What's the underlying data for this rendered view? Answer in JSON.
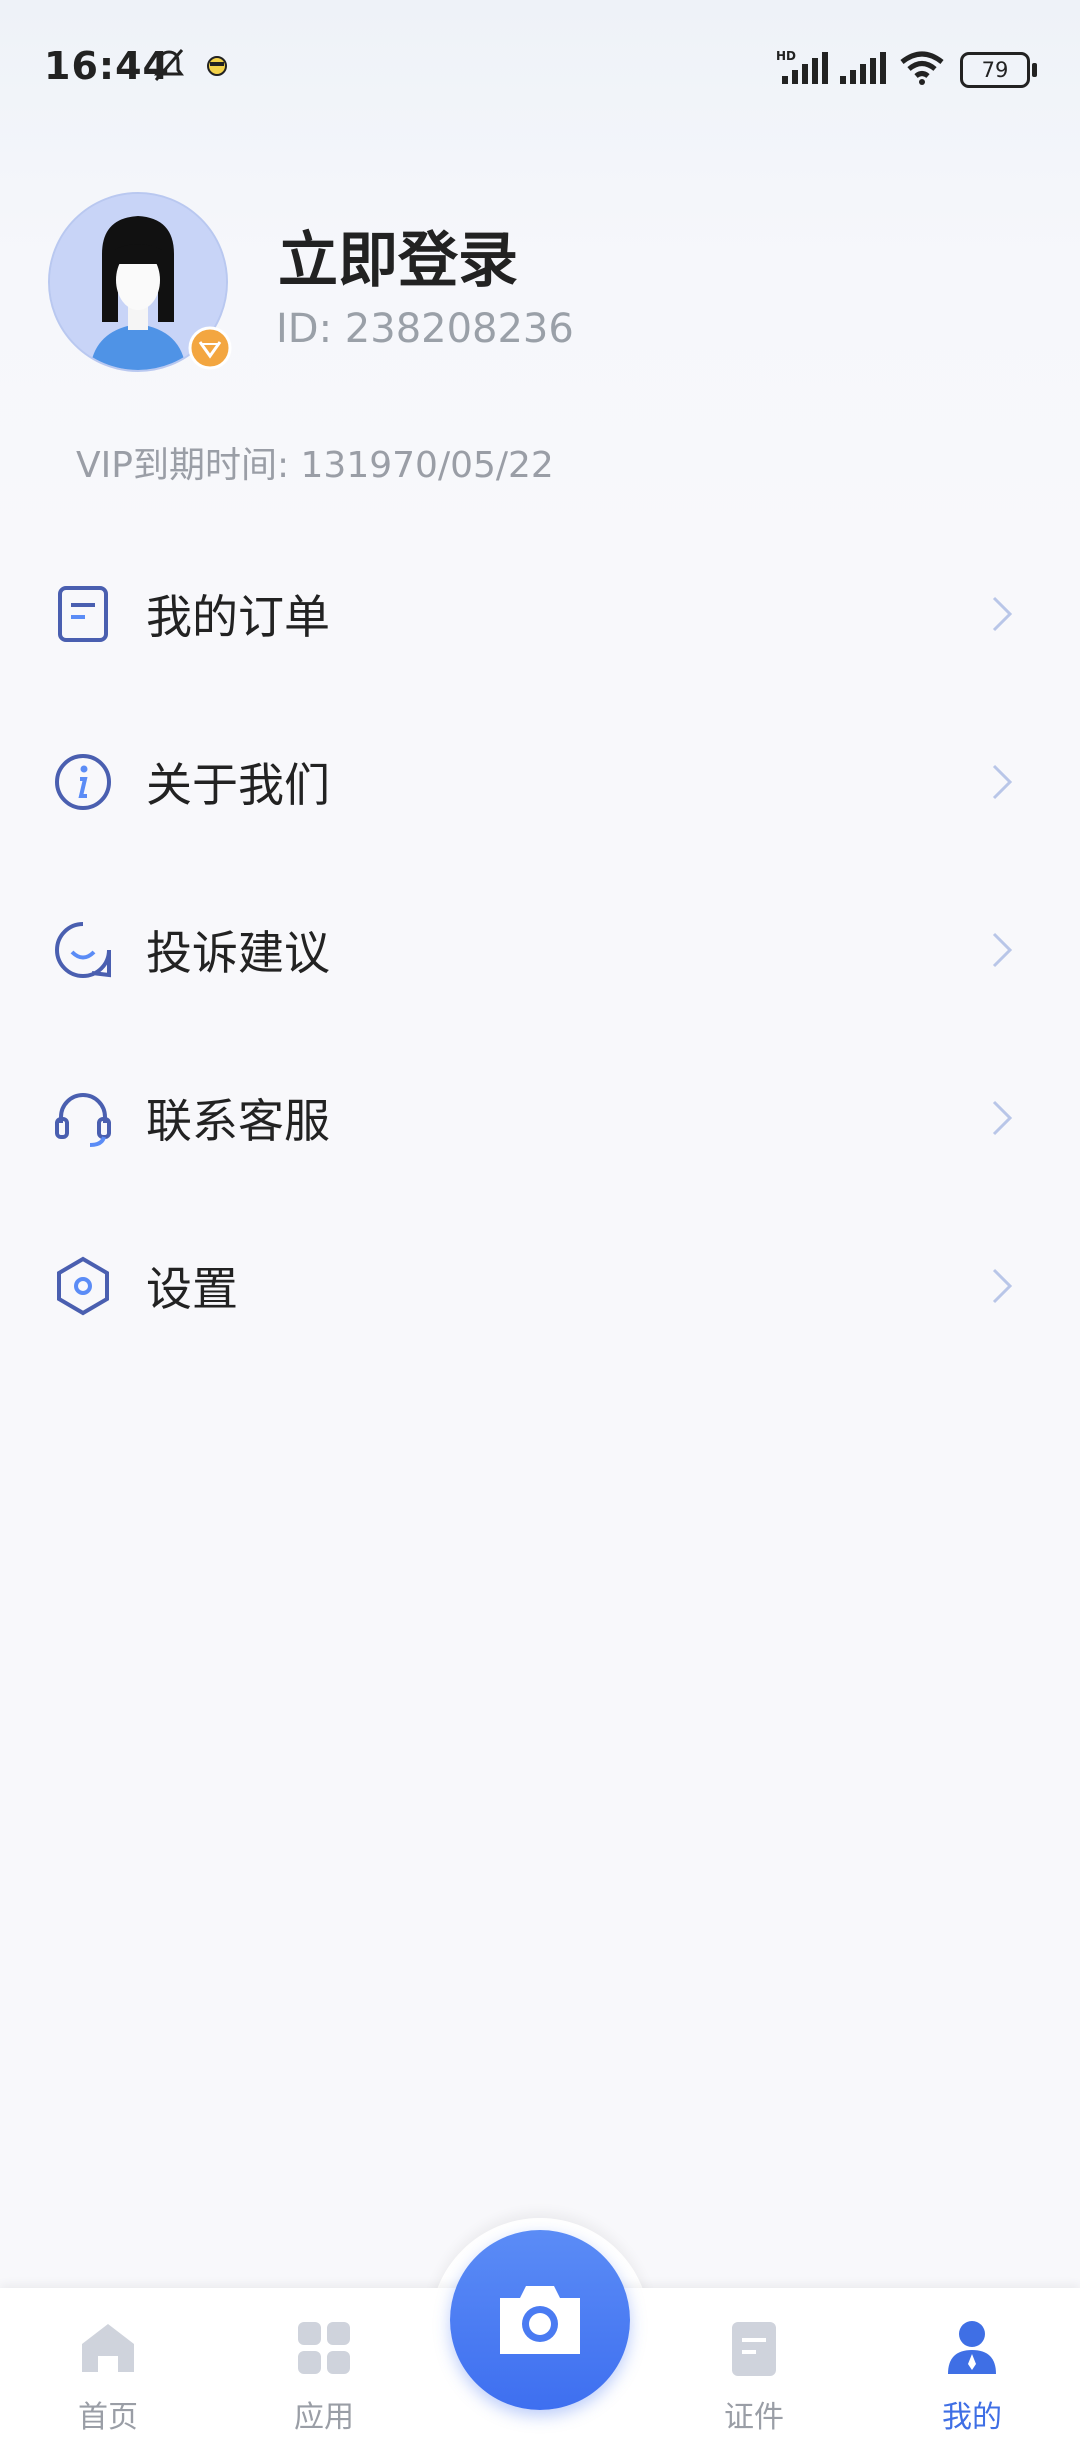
{
  "status_bar": {
    "time": "16:44",
    "battery": "79",
    "network_label": "HD"
  },
  "profile": {
    "title": "立即登录",
    "user_id": "ID: 238208236",
    "vip_expire": "VIP到期时间: 131970/05/22"
  },
  "menu": {
    "items": [
      {
        "label": "我的订单",
        "icon": "order-icon"
      },
      {
        "label": "关于我们",
        "icon": "info-icon"
      },
      {
        "label": "投诉建议",
        "icon": "chat-icon"
      },
      {
        "label": "联系客服",
        "icon": "headset-icon"
      },
      {
        "label": "设置",
        "icon": "settings-icon"
      }
    ]
  },
  "bottom_nav": {
    "items": [
      {
        "label": "首页",
        "icon": "home-icon"
      },
      {
        "label": "应用",
        "icon": "apps-icon"
      },
      {
        "label": "证件",
        "icon": "document-icon"
      },
      {
        "label": "我的",
        "icon": "profile-icon",
        "active": true
      }
    ],
    "center": {
      "icon": "camera-icon"
    }
  },
  "colors": {
    "accent": "#3f6fe5",
    "icon_stroke": "#4a5fb0",
    "vip_orange": "#f3a640"
  }
}
